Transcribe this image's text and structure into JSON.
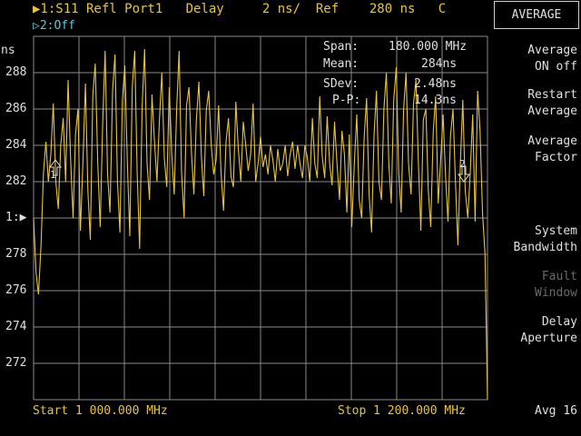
{
  "header": {
    "trace1": "▶1:S11 Refl Port1   Delay     2 ns/  Ref    280 ns   C",
    "trace2": "▷2:Off"
  },
  "y_axis": {
    "unit": "ns",
    "ticks": [
      "288",
      "286",
      "284",
      "282",
      "1:▶",
      "278",
      "276",
      "274",
      "272"
    ]
  },
  "stats": {
    "span_label": "Span:",
    "span_value": "180.000 MHz",
    "mean_label": "Mean:",
    "mean_value": "284ns",
    "sdev_label": "SDev:",
    "sdev_value": "2.48ns",
    "pp_label": "P-P:",
    "pp_value": "14.3ns"
  },
  "footer": {
    "start": "Start 1 000.000 MHz",
    "stop": "Stop 1 200.000 MHz"
  },
  "softkeys": {
    "menu_title": "AVERAGE",
    "average_on_off": "Average\nON  off",
    "restart_average": "Restart\nAverage",
    "average_factor": "Average\nFactor",
    "system_bandwidth": "System\nBandwidth",
    "fault_window": "Fault\nWindow",
    "delay_aperture": "Delay\nAperture",
    "avg_count": "Avg 16"
  },
  "markers": {
    "m1": "1",
    "m2": "2"
  },
  "colors": {
    "trace": "#e6c440",
    "grid": "#8a8a8a",
    "channel2": "#5fc8d8"
  },
  "chart_data": {
    "type": "line",
    "title": "",
    "xlabel": "",
    "ylabel": "ns",
    "xlim": [
      1000,
      1200
    ],
    "ylim": [
      270,
      290
    ],
    "grid": true,
    "series": [
      {
        "values": [
          280.0,
          277.0,
          275.8,
          278.5,
          282.5,
          284.2,
          282.0,
          283.5,
          286.3,
          282.0,
          280.5,
          284.0,
          285.5,
          282.0,
          287.6,
          283.2,
          280.0,
          284.6,
          286.0,
          279.3,
          283.0,
          287.4,
          281.5,
          278.8,
          286.7,
          288.5,
          283.0,
          279.5,
          285.2,
          289.2,
          282.4,
          280.3,
          287.0,
          289.0,
          282.0,
          279.2,
          286.5,
          288.4,
          283.0,
          279.0,
          287.2,
          289.2,
          282.5,
          278.3,
          286.2,
          289.3,
          283.0,
          281.0,
          286.8,
          284.2,
          282.0,
          285.4,
          288.0,
          283.3,
          281.7,
          287.2,
          283.5,
          281.3,
          286.0,
          289.2,
          282.5,
          280.0,
          286.2,
          287.2,
          283.6,
          281.3,
          285.4,
          287.5,
          283.4,
          281.2,
          285.9,
          287.0,
          284.0,
          282.4,
          283.2,
          286.2,
          282.5,
          280.4,
          284.2,
          285.5,
          282.3,
          281.7,
          286.4,
          283.8,
          282.0,
          285.3,
          284.0,
          282.6,
          283.5,
          286.3,
          282.0,
          283.0,
          284.5,
          282.8,
          283.5,
          282.4,
          284.0,
          283.2,
          282.0,
          283.8,
          282.6,
          283.0,
          284.0,
          282.3,
          283.5,
          284.2,
          282.7,
          284.0,
          283.0,
          282.2,
          284.0,
          283.3,
          282.0,
          285.5,
          283.0,
          282.2,
          286.7,
          283.4,
          282.2,
          285.6,
          283.0,
          281.8,
          285.3,
          283.0,
          281.0,
          284.8,
          283.5,
          280.3,
          284.6,
          279.5,
          283.0,
          285.7,
          281.0,
          280.0,
          284.4,
          286.6,
          281.3,
          279.2,
          284.5,
          287.0,
          282.0,
          281.0,
          286.0,
          288.0,
          283.0,
          280.8,
          286.5,
          288.3,
          282.5,
          280.3,
          286.0,
          288.0,
          283.0,
          281.3,
          286.3,
          287.6,
          283.0,
          279.3,
          285.4,
          286.0,
          281.5,
          279.5,
          284.7,
          286.7,
          280.8,
          283.2,
          285.7,
          282.3,
          279.8,
          284.5,
          286.0,
          282.0,
          278.5,
          283.0,
          286.5,
          281.5,
          280.0,
          282.5,
          285.7,
          279.8,
          287.0,
          284.8,
          280.2,
          278.0,
          270.0
        ]
      }
    ]
  }
}
